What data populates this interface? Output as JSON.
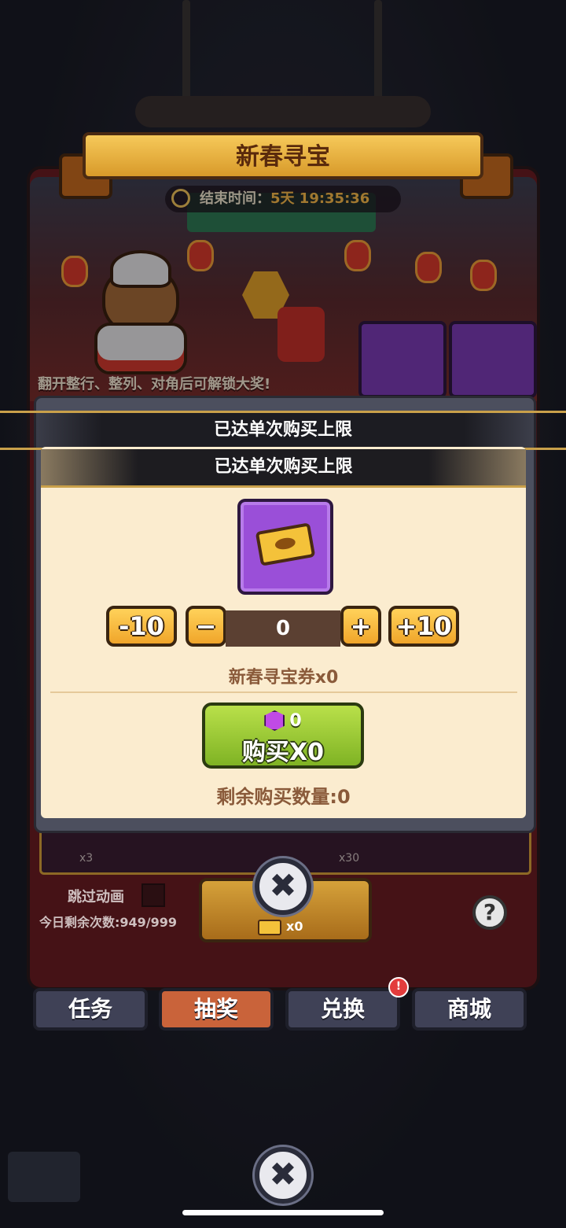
{
  "event": {
    "title": "新春寻宝",
    "end_time_label": "结束时间：",
    "end_time_value": "5天 19:35:36",
    "hint": "翻开整行、整列、对角后可解锁大奖!"
  },
  "popup": {
    "header_text": "已达单次购买上限",
    "title": "已达单次购买上限",
    "item_icon": "gold-ticket-icon",
    "minus10_label": "-10",
    "minus_label": "−",
    "quantity": "0",
    "plus_label": "+",
    "plus10_label": "+10",
    "item_name": "新春寻宝券x0",
    "buy": {
      "cost": "0",
      "label": "购买X0"
    },
    "remaining": "剩余购买数量:0"
  },
  "board": {
    "slot_labels": [
      "x3",
      "x30"
    ],
    "skip_animation": "跳过动画",
    "daily_remaining": "今日剩余次数:949/999",
    "draw_cost": "x0",
    "help": "?"
  },
  "close_icon_text": "✖",
  "tabs": [
    {
      "label": "任务"
    },
    {
      "label": "抽奖"
    },
    {
      "label": "兑换"
    },
    {
      "label": "商城"
    }
  ],
  "tab_badge": "!",
  "colors": {
    "accent": "#f0a52a",
    "buy_green": "#9bcb36",
    "panel_red": "#6b1d22",
    "popup_cream": "#fbeccf"
  }
}
